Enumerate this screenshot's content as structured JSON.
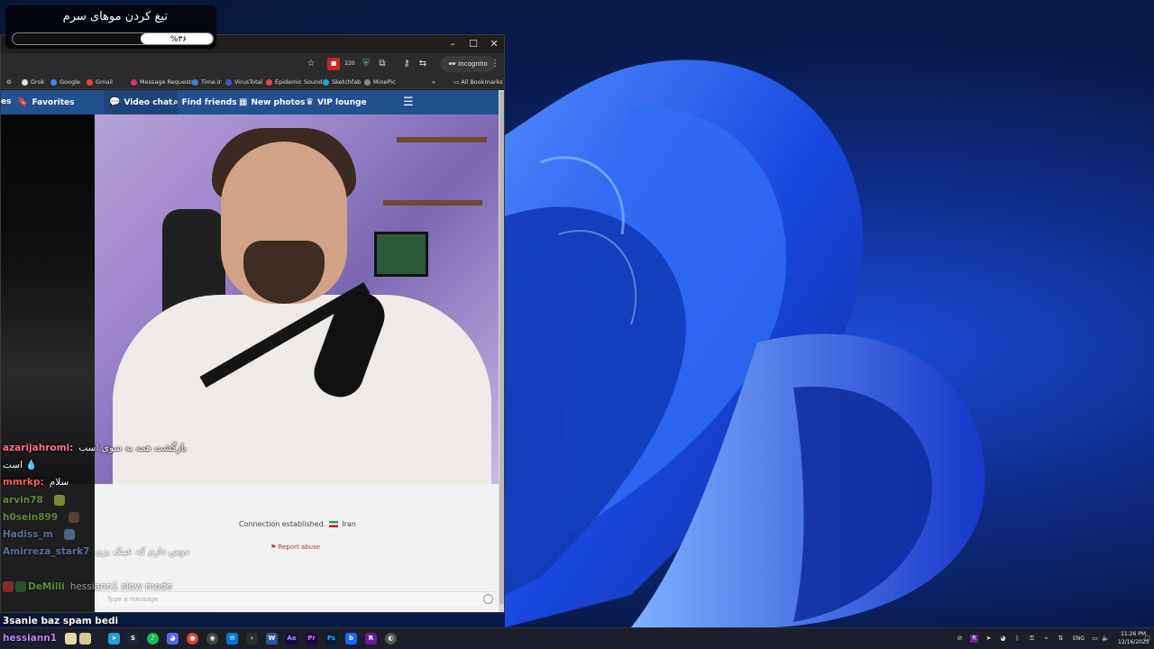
{
  "overlay": {
    "goal_title": "تیغ کردن موهای سرم",
    "goal_percent_text": "%۳۶",
    "goal_progress": 0.36
  },
  "browser": {
    "controls": {
      "minimize": "–",
      "maximize": "☐",
      "close": "✕"
    },
    "incognito_label": "Incognito",
    "toolbar_badge": "220",
    "bookmarks": [
      {
        "label": "Grok",
        "color": "#ffffff"
      },
      {
        "label": "Google",
        "color": "#4285f4"
      },
      {
        "label": "Gmail",
        "color": "#ea4335"
      },
      {
        "label": "Message Requests",
        "color": "#e1306c"
      },
      {
        "label": "Time.ir",
        "color": "#3b82f6"
      },
      {
        "label": "VirusTotal",
        "color": "#3b5bdb"
      },
      {
        "label": "Epidemic Sound",
        "color": "#e44"
      },
      {
        "label": "Sketchfab",
        "color": "#1caad9"
      },
      {
        "label": "MinePic",
        "color": "#888"
      }
    ],
    "all_bookmarks": "All Bookmarks",
    "overflow": "»"
  },
  "site": {
    "nav": {
      "partial": "es",
      "favorites": "Favorites",
      "video_chat": "Video chat",
      "find_friends": "Find friends",
      "new_photos": "New photos",
      "vip_lounge": "VIP lounge"
    },
    "connection_text": "Connection established.",
    "country": "Iran",
    "report": "Report abuse",
    "message_placeholder": "Type a message"
  },
  "chat": [
    {
      "user": "azarijahromi:",
      "color": "#ff6f8f",
      "message": "بازگشت همه به سوی اسب",
      "faded": false
    },
    {
      "user": "",
      "color": "#ffffff",
      "message": "است 💧",
      "faded": false
    },
    {
      "user": "mmrkp:",
      "color": "#ff5a5a",
      "message": "سلام",
      "faded": false
    },
    {
      "user": "arvin78",
      "color": "#8be04f",
      "message": "",
      "faded": true
    },
    {
      "user": "h0sein899",
      "color": "#8be04f",
      "message": "",
      "faded": true
    },
    {
      "user": "Hadiss_m",
      "color": "#7fb0ff",
      "message": "",
      "faded": true
    },
    {
      "user": "Amirreza_stark7",
      "color": "#7fb0ff",
      "message": "دوس دارم که عینک بزن",
      "faded": true
    },
    {
      "user": "DeMilli",
      "color": "#8be04f",
      "message": "hessiann1 slow mode",
      "faded": true
    },
    {
      "user": "",
      "color": "#ffffff",
      "message": "3sanie baz spam bedi",
      "faded": false
    },
    {
      "user": "hessiann1",
      "color": "#c77dff",
      "message": "",
      "faded": false
    }
  ],
  "taskbar": {
    "apps": [
      {
        "label": "",
        "color": "#3b7cff"
      },
      {
        "label": "",
        "color": "#229ed9"
      },
      {
        "label": "",
        "color": "#1b2838"
      },
      {
        "label": "",
        "color": "#1db954"
      },
      {
        "label": "",
        "color": "#5865f2"
      },
      {
        "label": "",
        "color": "#db4437"
      },
      {
        "label": "",
        "color": "#444"
      },
      {
        "label": "",
        "color": "#0078d4"
      },
      {
        "label": "",
        "color": "#2d2d2d"
      },
      {
        "label": "",
        "color": "#2b579a"
      },
      {
        "label": "Ae",
        "color": "#1f0740"
      },
      {
        "label": "Pr",
        "color": "#1f0740"
      },
      {
        "label": "Ps",
        "color": "#001e36"
      },
      {
        "label": "b",
        "color": "#1769ff"
      },
      {
        "label": "R",
        "color": "#6a1b9a"
      },
      {
        "label": "",
        "color": "#555"
      }
    ],
    "language": "ENG",
    "time": "11:26 PM",
    "date": "12/16/2025"
  }
}
